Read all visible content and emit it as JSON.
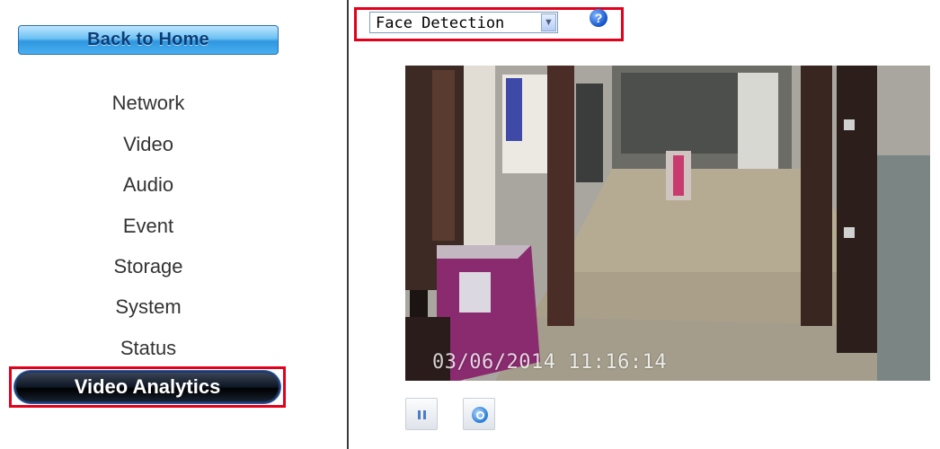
{
  "sidebar": {
    "home_button": "Back to Home",
    "items": [
      {
        "label": "Network"
      },
      {
        "label": "Video"
      },
      {
        "label": "Audio"
      },
      {
        "label": "Event"
      },
      {
        "label": "Storage"
      },
      {
        "label": "System"
      },
      {
        "label": "Status"
      }
    ],
    "active_item": "Video Analytics"
  },
  "analytics": {
    "mode_select": {
      "value": "Face Detection"
    },
    "help_icon": "help-question-icon"
  },
  "video": {
    "timestamp": "03/06/2014   11:16:14"
  },
  "controls": {
    "pause_icon": "pause-icon",
    "zoom_icon": "zoom-icon"
  },
  "colors": {
    "highlight": "#e3001b",
    "home_button": "#2f97e0",
    "active_item": "#000000"
  }
}
